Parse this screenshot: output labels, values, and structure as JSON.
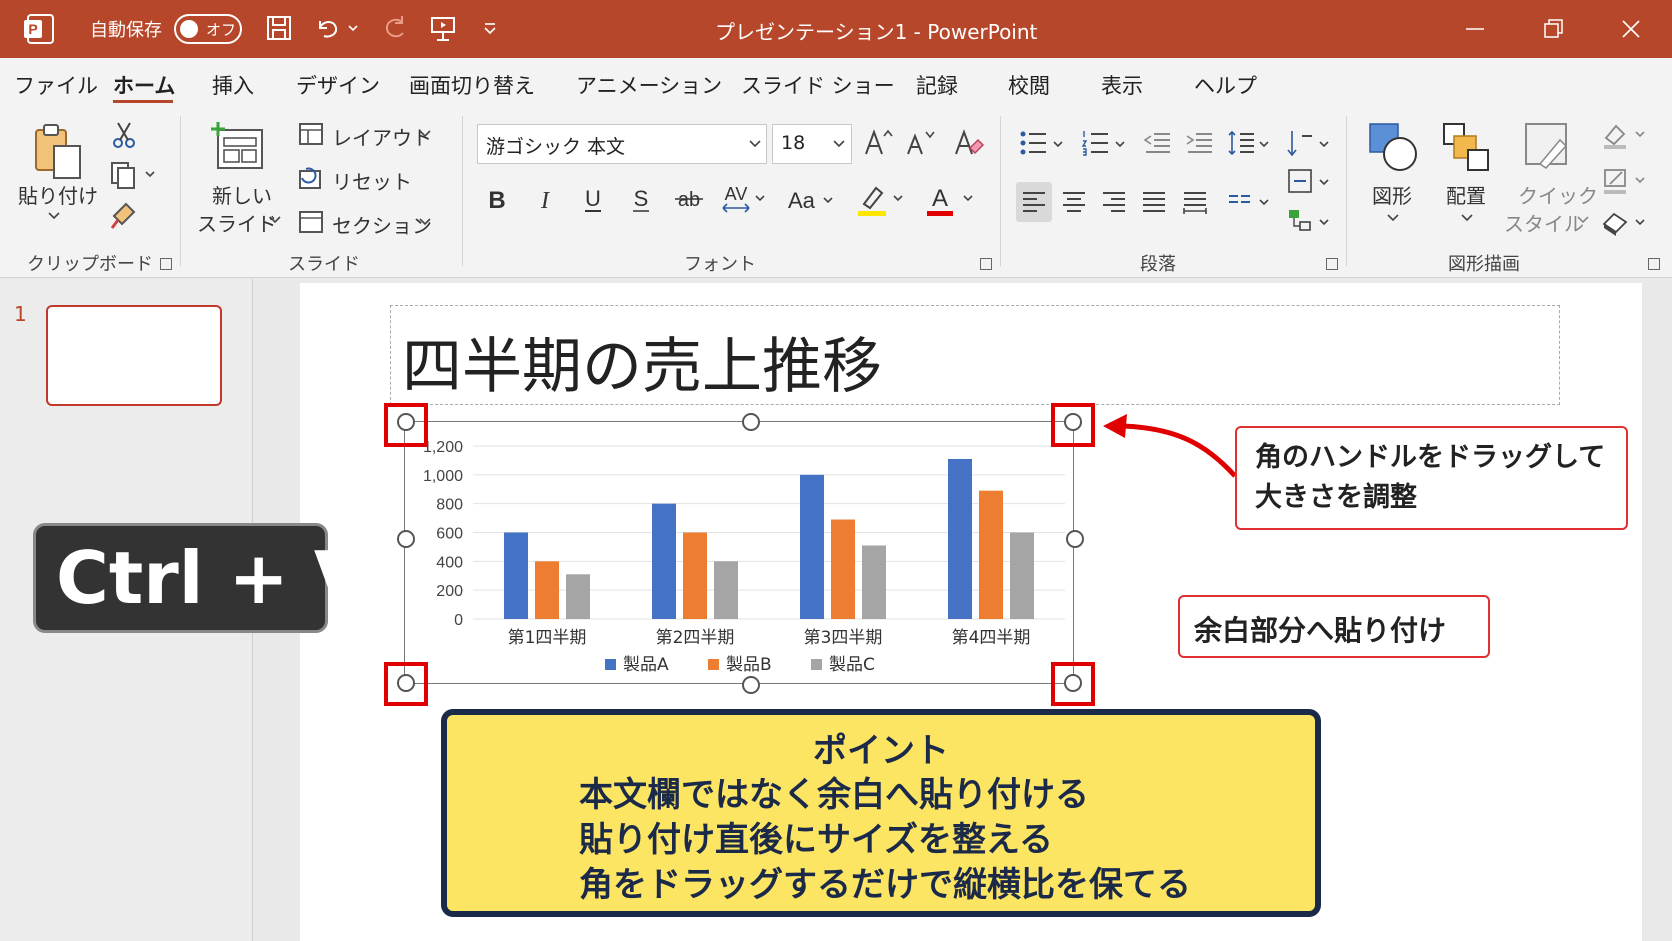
{
  "titlebar": {
    "autosave_label": "自動保存",
    "toggle_label": "オフ",
    "window_title": "プレゼンテーション1 - PowerPoint"
  },
  "menu": [
    "ファイル",
    "ホーム",
    "挿入",
    "デザイン",
    "画面切り替え",
    "アニメーション",
    "スライド ショー",
    "記録",
    "校閲",
    "表示",
    "ヘルプ"
  ],
  "ribbon": {
    "clipboard": {
      "paste": "貼り付け",
      "group": "クリップボード"
    },
    "slides": {
      "new1": "新しい",
      "new2": "スライド",
      "layout": "レイアウト",
      "reset": "リセット",
      "section": "セクション",
      "group": "スライド"
    },
    "font": {
      "name": "游ゴシック 本文",
      "size": "18",
      "group": "フォント"
    },
    "paragraph": {
      "group": "段落"
    },
    "drawing": {
      "shapes": "図形",
      "arrange": "配置",
      "quick1": "クイック",
      "quick2": "スタイル",
      "group": "図形描画"
    }
  },
  "slide_pane": {
    "number": "1"
  },
  "slide": {
    "title": "四半期の売上推移"
  },
  "chart_data": {
    "type": "bar",
    "categories": [
      "第1四半期",
      "第2四半期",
      "第3四半期",
      "第4四半期"
    ],
    "series": [
      {
        "name": "製品A",
        "color": "#4472c4",
        "values": [
          600,
          800,
          1000,
          1110
        ]
      },
      {
        "name": "製品B",
        "color": "#ed7d31",
        "values": [
          400,
          600,
          690,
          890
        ]
      },
      {
        "name": "製品C",
        "color": "#a5a5a5",
        "values": [
          310,
          400,
          510,
          600
        ]
      }
    ],
    "ylim": [
      0,
      1200
    ],
    "yticks": [
      "0",
      "200",
      "400",
      "600",
      "800",
      "1,000",
      "1,200"
    ],
    "legend": "bottom"
  },
  "callouts": {
    "resize_line1": "角のハンドルをドラッグして",
    "resize_line2": "大きさを調整",
    "paste_blank": "余白部分へ貼り付け"
  },
  "shortcut": "Ctrl + V",
  "point": {
    "heading": "ポイント",
    "lines": [
      "本文欄ではなく余白へ貼り付ける",
      "貼り付け直後にサイズを整える",
      "角をドラッグするだけで縦横比を保てる"
    ]
  },
  "colors": {
    "accent": "#b7472a",
    "callout_border": "#e03030",
    "point_bg": "#fde564",
    "point_border": "#1c2a4a"
  }
}
